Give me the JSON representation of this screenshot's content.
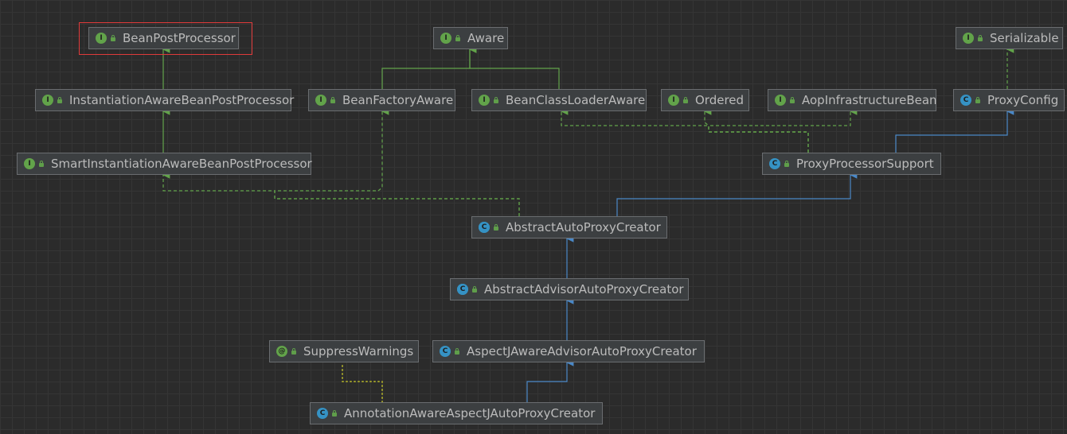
{
  "diagram": {
    "nodes": [
      {
        "id": "bpp",
        "label": "BeanPostProcessor",
        "kind": "interface",
        "kind_letter": "I"
      },
      {
        "id": "aware",
        "label": "Aware",
        "kind": "interface",
        "kind_letter": "I"
      },
      {
        "id": "serializable",
        "label": "Serializable",
        "kind": "interface",
        "kind_letter": "I"
      },
      {
        "id": "iabpp",
        "label": "InstantiationAwareBeanPostProcessor",
        "kind": "interface",
        "kind_letter": "I"
      },
      {
        "id": "bfa",
        "label": "BeanFactoryAware",
        "kind": "interface",
        "kind_letter": "I"
      },
      {
        "id": "bcla",
        "label": "BeanClassLoaderAware",
        "kind": "interface",
        "kind_letter": "I"
      },
      {
        "id": "ordered",
        "label": "Ordered",
        "kind": "interface",
        "kind_letter": "I"
      },
      {
        "id": "aib",
        "label": "AopInfrastructureBean",
        "kind": "interface",
        "kind_letter": "I"
      },
      {
        "id": "proxyconfig",
        "label": "ProxyConfig",
        "kind": "class",
        "kind_letter": "C"
      },
      {
        "id": "siabpp",
        "label": "SmartInstantiationAwareBeanPostProcessor",
        "kind": "interface",
        "kind_letter": "I"
      },
      {
        "id": "pps",
        "label": "ProxyProcessorSupport",
        "kind": "class",
        "kind_letter": "C"
      },
      {
        "id": "aapc",
        "label": "AbstractAutoProxyCreator",
        "kind": "abstract",
        "kind_letter": "C"
      },
      {
        "id": "aaapc",
        "label": "AbstractAdvisorAutoProxyCreator",
        "kind": "abstract",
        "kind_letter": "C"
      },
      {
        "id": "sw",
        "label": "SuppressWarnings",
        "kind": "annotation",
        "kind_letter": "@"
      },
      {
        "id": "ajaapc",
        "label": "AspectJAwareAdvisorAutoProxyCreator",
        "kind": "class",
        "kind_letter": "C"
      },
      {
        "id": "aajapc",
        "label": "AnnotationAwareAspectJAutoProxyCreator",
        "kind": "class",
        "kind_letter": "C"
      }
    ],
    "edges": [
      {
        "from": "iabpp",
        "to": "bpp",
        "type": "extends"
      },
      {
        "from": "siabpp",
        "to": "iabpp",
        "type": "extends"
      },
      {
        "from": "bfa",
        "to": "aware",
        "type": "extends"
      },
      {
        "from": "bcla",
        "to": "aware",
        "type": "extends"
      },
      {
        "from": "aapc",
        "to": "siabpp",
        "type": "implements"
      },
      {
        "from": "aapc",
        "to": "bfa",
        "type": "implements"
      },
      {
        "from": "aapc",
        "to": "pps",
        "type": "extends-class"
      },
      {
        "from": "pps",
        "to": "bcla",
        "type": "implements"
      },
      {
        "from": "pps",
        "to": "ordered",
        "type": "implements"
      },
      {
        "from": "pps",
        "to": "aib",
        "type": "implements"
      },
      {
        "from": "pps",
        "to": "proxyconfig",
        "type": "extends-class"
      },
      {
        "from": "proxyconfig",
        "to": "serializable",
        "type": "implements"
      },
      {
        "from": "aaapc",
        "to": "aapc",
        "type": "extends-class"
      },
      {
        "from": "ajaapc",
        "to": "aaapc",
        "type": "extends-class"
      },
      {
        "from": "aajapc",
        "to": "ajaapc",
        "type": "extends-class"
      },
      {
        "from": "aajapc",
        "to": "sw",
        "type": "annotated"
      }
    ],
    "selected_node": "bpp",
    "colors": {
      "background": "#2b2b2b",
      "grid": "#353535",
      "node_fill": "#3c3f41",
      "node_border": "#6a6d70",
      "node_text": "#bbbbbb",
      "interface_edge": "#62a34a",
      "class_edge": "#4a88c7",
      "annotation_edge": "#9a9a2a",
      "selection": "#e03a3a"
    }
  }
}
